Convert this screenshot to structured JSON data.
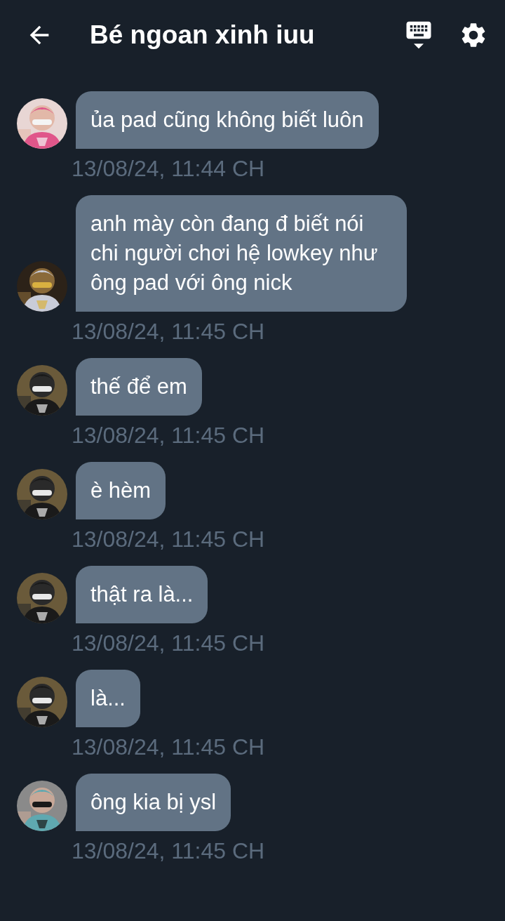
{
  "header": {
    "title": "Bé ngoan xinh iuu"
  },
  "messages": [
    {
      "text": "ủa pad cũng không biết luôn",
      "time": "13/08/24, 11:44 CH"
    },
    {
      "text": "anh mày còn đang đ biết nói chi người chơi hệ lowkey như ông pad với ông nick",
      "time": "13/08/24, 11:45 CH"
    },
    {
      "text": "thế để em",
      "time": "13/08/24, 11:45 CH"
    },
    {
      "text": "è hèm",
      "time": "13/08/24, 11:45 CH"
    },
    {
      "text": "thật ra là...",
      "time": "13/08/24, 11:45 CH"
    },
    {
      "text": "là...",
      "time": "13/08/24, 11:45 CH"
    },
    {
      "text": "ông kia bị ysl",
      "time": "13/08/24, 11:45 CH"
    }
  ]
}
